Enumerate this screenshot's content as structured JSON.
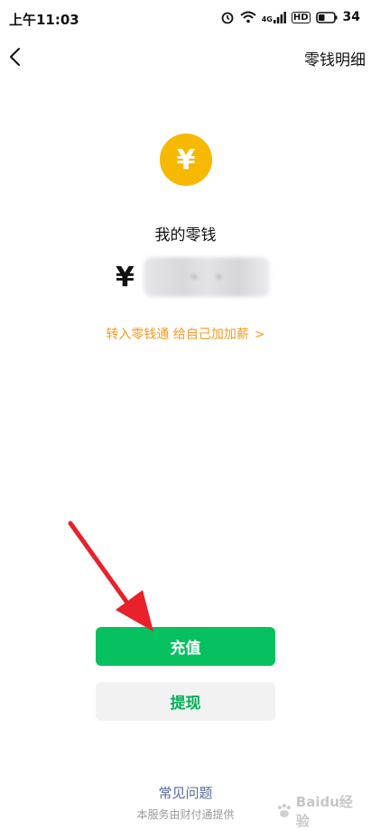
{
  "status_bar": {
    "time": "上午11:03",
    "network": "4G",
    "hd": "HD",
    "battery": "34"
  },
  "header": {
    "detail_link": "零钱明细"
  },
  "balance": {
    "currency_symbol": "¥",
    "title": "我的零钱",
    "amount_hidden": true
  },
  "promo": {
    "text": "转入零钱通 给自己加加薪",
    "chevron": ">"
  },
  "actions": {
    "recharge_label": "充值",
    "withdraw_label": "提现"
  },
  "footer": {
    "faq_link": "常见问题",
    "provider_text": "本服务由财付通提供"
  },
  "watermark": {
    "text": "Baidu经验"
  },
  "colors": {
    "coin": "#f7b900",
    "primary_green": "#07c160",
    "promo_orange": "#f29a27",
    "link_blue": "#576b95",
    "annotation_arrow": "#e8212b"
  },
  "icons": {
    "coin": "yen-coin-icon",
    "back": "chevron-left-icon",
    "annotation": "red-arrow-annotation"
  }
}
